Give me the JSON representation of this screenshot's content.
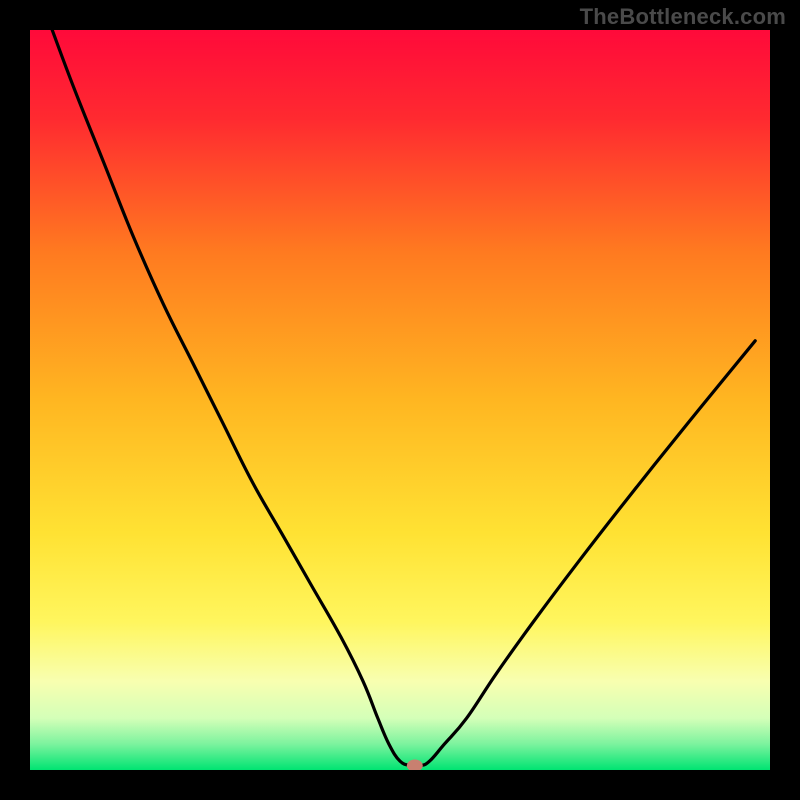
{
  "watermark": "TheBottleneck.com",
  "chart_data": {
    "type": "line",
    "title": "",
    "xlabel": "",
    "ylabel": "",
    "xlim": [
      0,
      100
    ],
    "ylim": [
      0,
      100
    ],
    "background_gradient": {
      "stops": [
        {
          "offset": 0.0,
          "color": "#ff0a3a"
        },
        {
          "offset": 0.12,
          "color": "#ff2a30"
        },
        {
          "offset": 0.3,
          "color": "#ff7a20"
        },
        {
          "offset": 0.5,
          "color": "#ffb621"
        },
        {
          "offset": 0.68,
          "color": "#ffe233"
        },
        {
          "offset": 0.8,
          "color": "#fff65e"
        },
        {
          "offset": 0.88,
          "color": "#f8ffb0"
        },
        {
          "offset": 0.93,
          "color": "#d4ffb8"
        },
        {
          "offset": 0.965,
          "color": "#7cf39e"
        },
        {
          "offset": 1.0,
          "color": "#00e472"
        }
      ]
    },
    "series": [
      {
        "name": "bottleneck-curve",
        "color": "#000000",
        "x": [
          3,
          6,
          10,
          14,
          18,
          22,
          26,
          30,
          34,
          38,
          42,
          45,
          47,
          48.5,
          50,
          51.5,
          52.8,
          54,
          56,
          59,
          63,
          68,
          74,
          81,
          89,
          98
        ],
        "y": [
          100,
          92,
          82,
          72,
          63,
          55,
          47,
          39,
          32,
          25,
          18,
          12,
          7,
          3.5,
          1.2,
          0.6,
          0.6,
          1.2,
          3.5,
          7,
          13,
          20,
          28,
          37,
          47,
          58
        ]
      }
    ],
    "marker": {
      "name": "optimal-point",
      "x": 52,
      "y": 0.6,
      "color": "#c88070",
      "rx": 8,
      "ry": 6
    }
  }
}
